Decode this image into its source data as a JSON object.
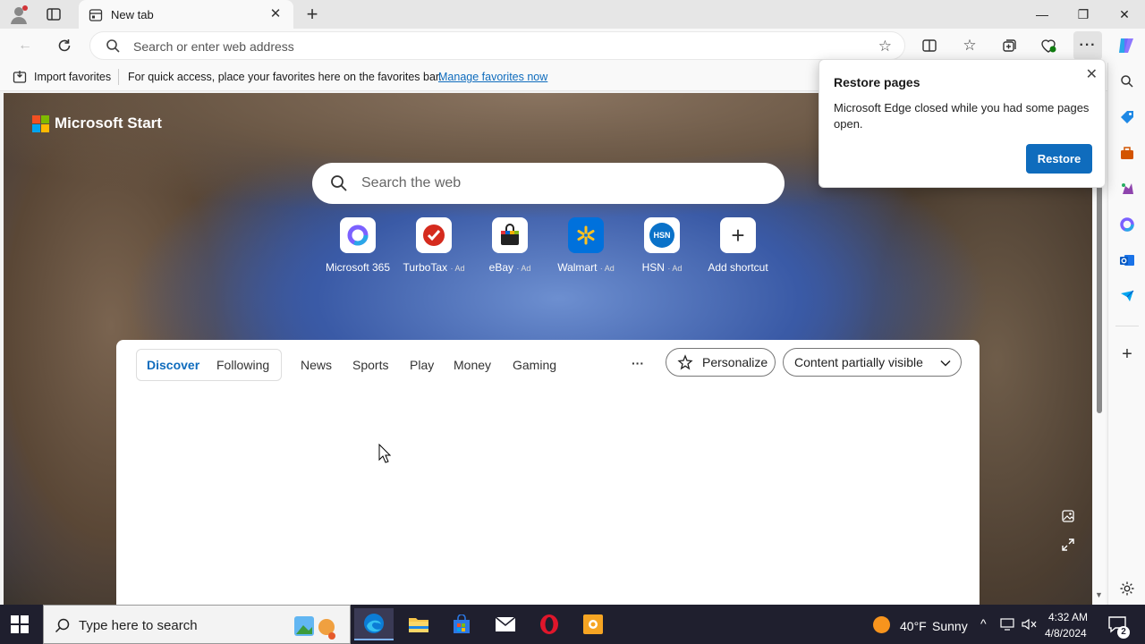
{
  "browser": {
    "tab_title": "New tab",
    "address_placeholder": "Search or enter web address",
    "window_controls": [
      "minimize-icon",
      "restore-icon",
      "close-icon"
    ]
  },
  "favorites_bar": {
    "import_label": "Import favorites",
    "hint": "For quick access, place your favorites here on the favorites bar.",
    "manage_link": "Manage favorites now"
  },
  "newtab": {
    "brand": "Microsoft Start",
    "search_placeholder": "Search the web",
    "shortcuts": [
      {
        "label": "Microsoft 365",
        "ad": "",
        "icon": "microsoft-365-icon"
      },
      {
        "label": "TurboTax",
        "ad": "· Ad",
        "icon": "turbotax-icon"
      },
      {
        "label": "eBay",
        "ad": "· Ad",
        "icon": "ebay-icon"
      },
      {
        "label": "Walmart",
        "ad": "· Ad",
        "icon": "walmart-icon"
      },
      {
        "label": "HSN",
        "ad": "· Ad",
        "icon": "hsn-icon"
      },
      {
        "label": "Add shortcut",
        "ad": "",
        "icon": "plus-icon"
      }
    ],
    "hsn_logo_text": "HSN",
    "feed_tabs": [
      "Discover",
      "Following",
      "News",
      "Sports",
      "Play",
      "Money",
      "Gaming"
    ],
    "more_label": "···",
    "personalize_label": "Personalize",
    "visibility_label": "Content partially visible"
  },
  "popup": {
    "title": "Restore pages",
    "message": "Microsoft Edge closed while you had some pages open.",
    "button": "Restore"
  },
  "taskbar": {
    "search_placeholder": "Type here to search",
    "weather_temp": "40°F",
    "weather_text": "Sunny",
    "time": "4:32 AM",
    "date": "4/8/2024",
    "notification_count": "2"
  },
  "colors": {
    "accent": "#0f6cbd",
    "link": "#0f6cbd",
    "taskbar_bg": "#1f1f2e",
    "brand_red": "#f25022",
    "brand_green": "#7fba00",
    "brand_blue": "#00a4ef",
    "brand_yellow": "#ffb900"
  }
}
